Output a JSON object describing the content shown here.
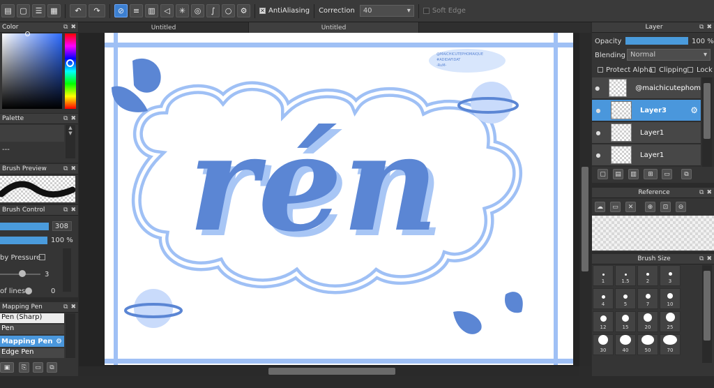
{
  "toolbar": {
    "antialiasing_label": "AntiAliasing",
    "correction_label": "Correction",
    "correction_value": "40",
    "softedge_label": "Soft Edge"
  },
  "tabs": [
    "Untitled",
    "Untitled"
  ],
  "color_panel": {
    "title": "Color"
  },
  "palette_panel": {
    "title": "Palette",
    "item": "---"
  },
  "brush_preview_panel": {
    "title": "Brush Preview"
  },
  "brush_control_panel": {
    "title": "Brush Control",
    "size_value": "308",
    "opacity_value": "100 %",
    "pressure_label": "by Pressure",
    "stepper_value": "3",
    "lines_label": "of lines",
    "lines_value": "0"
  },
  "brush_list_panel": {
    "title": "Mapping Pen",
    "items": [
      "Pen (Sharp)",
      "Pen",
      "Mapping Pen",
      "Edge Pen"
    ]
  },
  "layer_panel": {
    "title": "Layer",
    "opacity_label": "Opacity",
    "opacity_value": "100 %",
    "blending_label": "Blending",
    "blending_value": "Normal",
    "protect_alpha": "Protect Alpha",
    "clipping": "Clipping",
    "lock": "Lock",
    "layers": [
      "@maichicutephom",
      "Layer3",
      "Layer1",
      "Layer1"
    ]
  },
  "reference_panel": {
    "title": "Reference"
  },
  "brush_size_panel": {
    "title": "Brush Size",
    "sizes": [
      "1",
      "1.5",
      "2",
      "3",
      "4",
      "5",
      "7",
      "10",
      "12",
      "15",
      "20",
      "25",
      "30",
      "40",
      "50",
      "70"
    ]
  },
  "artwork": {
    "word": "rén",
    "watermark_lines": [
      "@MAICHICUTEPHOMAIQUE",
      "#ADIDAFIDAT",
      "-RuM-"
    ]
  },
  "colors": {
    "blue": "#5b86d4",
    "light_blue": "#a8c6f5",
    "pale_blue": "#c9dbfb",
    "accent": "#4a97dc"
  }
}
